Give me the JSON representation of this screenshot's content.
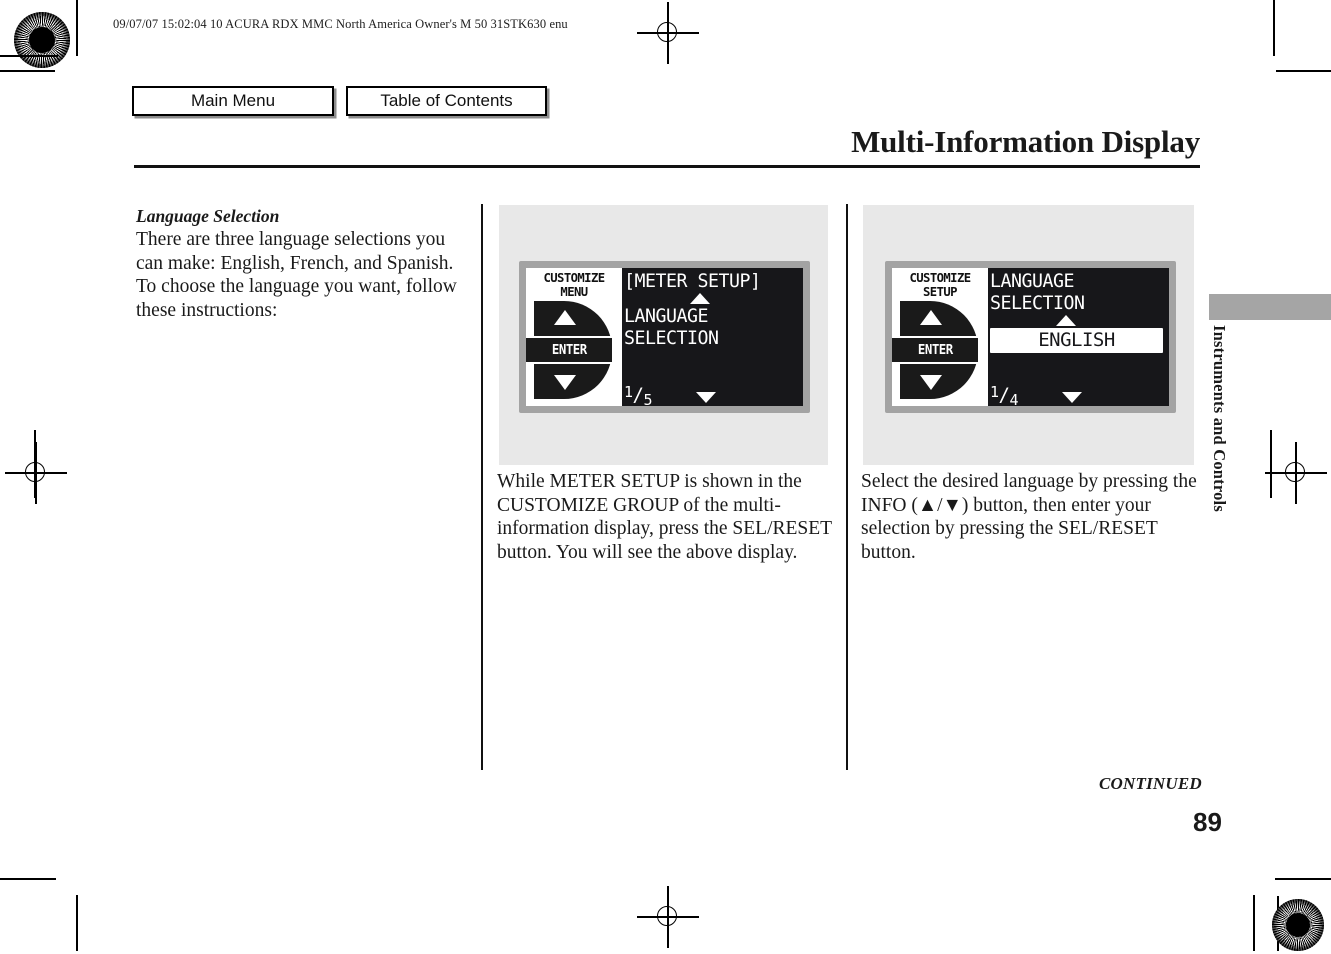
{
  "document_header": "09/07/07 15:02:04    10 ACURA RDX MMC North America Owner's M 50 31STK630 enu",
  "nav": {
    "main_menu_label": "Main Menu",
    "table_of_contents_label": "Table of Contents"
  },
  "page_title": "Multi-Information Display",
  "left_column": {
    "heading": "Language Selection",
    "body": "There are three language selections you can make: English, French, and Spanish. To choose the language you want, follow these instructions:"
  },
  "figure_1": {
    "side_title": "CUSTOMIZE\nMENU",
    "enter_label": "ENTER",
    "header_line": "[METER SETUP]",
    "line_1": "LANGUAGE",
    "line_2": "SELECTION",
    "page_indicator_numerator": "1",
    "page_indicator_slash": "/",
    "page_indicator_denominator": "5",
    "caption": "While METER SETUP is shown in the CUSTOMIZE GROUP of the multi-information display, press the SEL/RESET button. You will see the above display."
  },
  "figure_2": {
    "side_title": "CUSTOMIZE\nSETUP",
    "enter_label": "ENTER",
    "line_1": "LANGUAGE",
    "line_2": "SELECTION",
    "selected_value": "ENGLISH",
    "page_indicator_numerator": "1",
    "page_indicator_slash": "/",
    "page_indicator_denominator": "4",
    "caption": "Select the desired language by pressing the INFO (▲/▼) button, then enter your selection by pressing the SEL/RESET button."
  },
  "chapter_tab": "Instruments and Controls",
  "footer": {
    "continued": "CONTINUED",
    "page_number": "89"
  },
  "colors": {
    "lcd_screen": "#17171a",
    "lcd_bezel": "#a3a3a3",
    "figure_panel": "#e8e8e8",
    "edge_tab": "#a5a5a5",
    "rule": "#111111"
  }
}
